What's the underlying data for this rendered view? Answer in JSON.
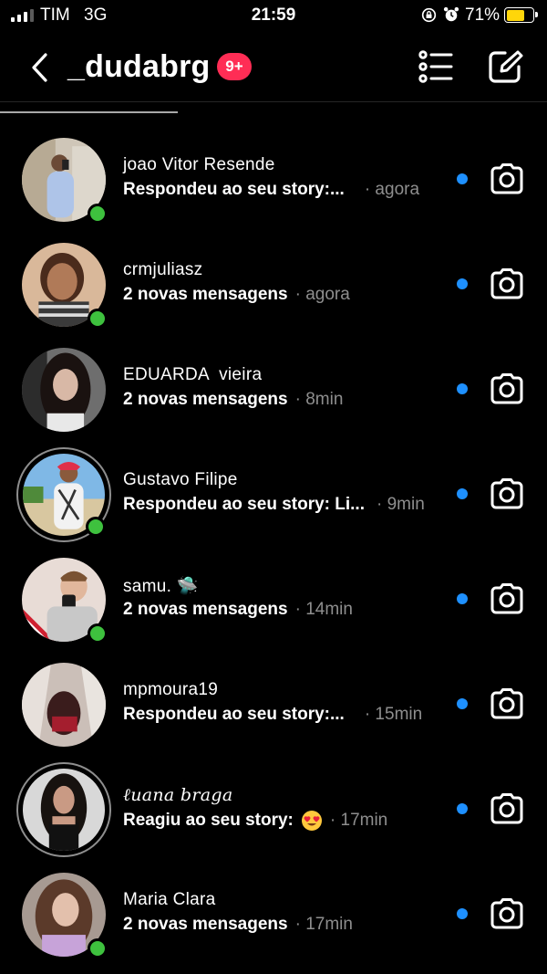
{
  "status_bar": {
    "carrier": "TIM",
    "network": "3G",
    "time": "21:59",
    "battery_percent": "71%",
    "battery_level": 0.71,
    "battery_color": "#ffd60a"
  },
  "header": {
    "title": "_dudabrg",
    "badge": "9+",
    "back_icon": "chevron-left-icon",
    "list_icon": "list-icon",
    "compose_icon": "compose-icon"
  },
  "conversations": [
    {
      "name": "joao Vitor Resende",
      "preview": "Respondeu ao seu story:...",
      "time": "· agora",
      "online": true,
      "unread": true
    },
    {
      "name": "crmjuliasz",
      "preview": "2 novas mensagens",
      "time": "· agora",
      "online": true,
      "unread": true
    },
    {
      "name": "EDUARDA  vieira",
      "preview": "2 novas mensagens",
      "time": "· 8min",
      "online": false,
      "unread": true
    },
    {
      "name": "Gustavo Filipe",
      "preview": "Respondeu ao seu story: Li...",
      "time": "· 9min",
      "online": true,
      "unread": true,
      "story_ring": true
    },
    {
      "name": "samu. 🛸",
      "preview": "2 novas mensagens",
      "time": "· 14min",
      "online": true,
      "unread": true
    },
    {
      "name": "mpmoura19",
      "preview": "Respondeu ao seu story:...",
      "time": "· 15min",
      "online": false,
      "unread": true
    },
    {
      "name": "ℓuana braga ",
      "preview": "Reagiu ao seu story:",
      "time": "· 17min",
      "online": false,
      "unread": true,
      "story_ring": true,
      "reaction_emoji": "heart-eyes-emoji"
    },
    {
      "name": "Maria Clara",
      "preview": "2 novas mensagens",
      "time": "· 17min",
      "online": true,
      "unread": true
    }
  ],
  "colors": {
    "unread_dot": "#1e90ff",
    "online": "#3ec13e",
    "badge": "#ff2d55"
  }
}
